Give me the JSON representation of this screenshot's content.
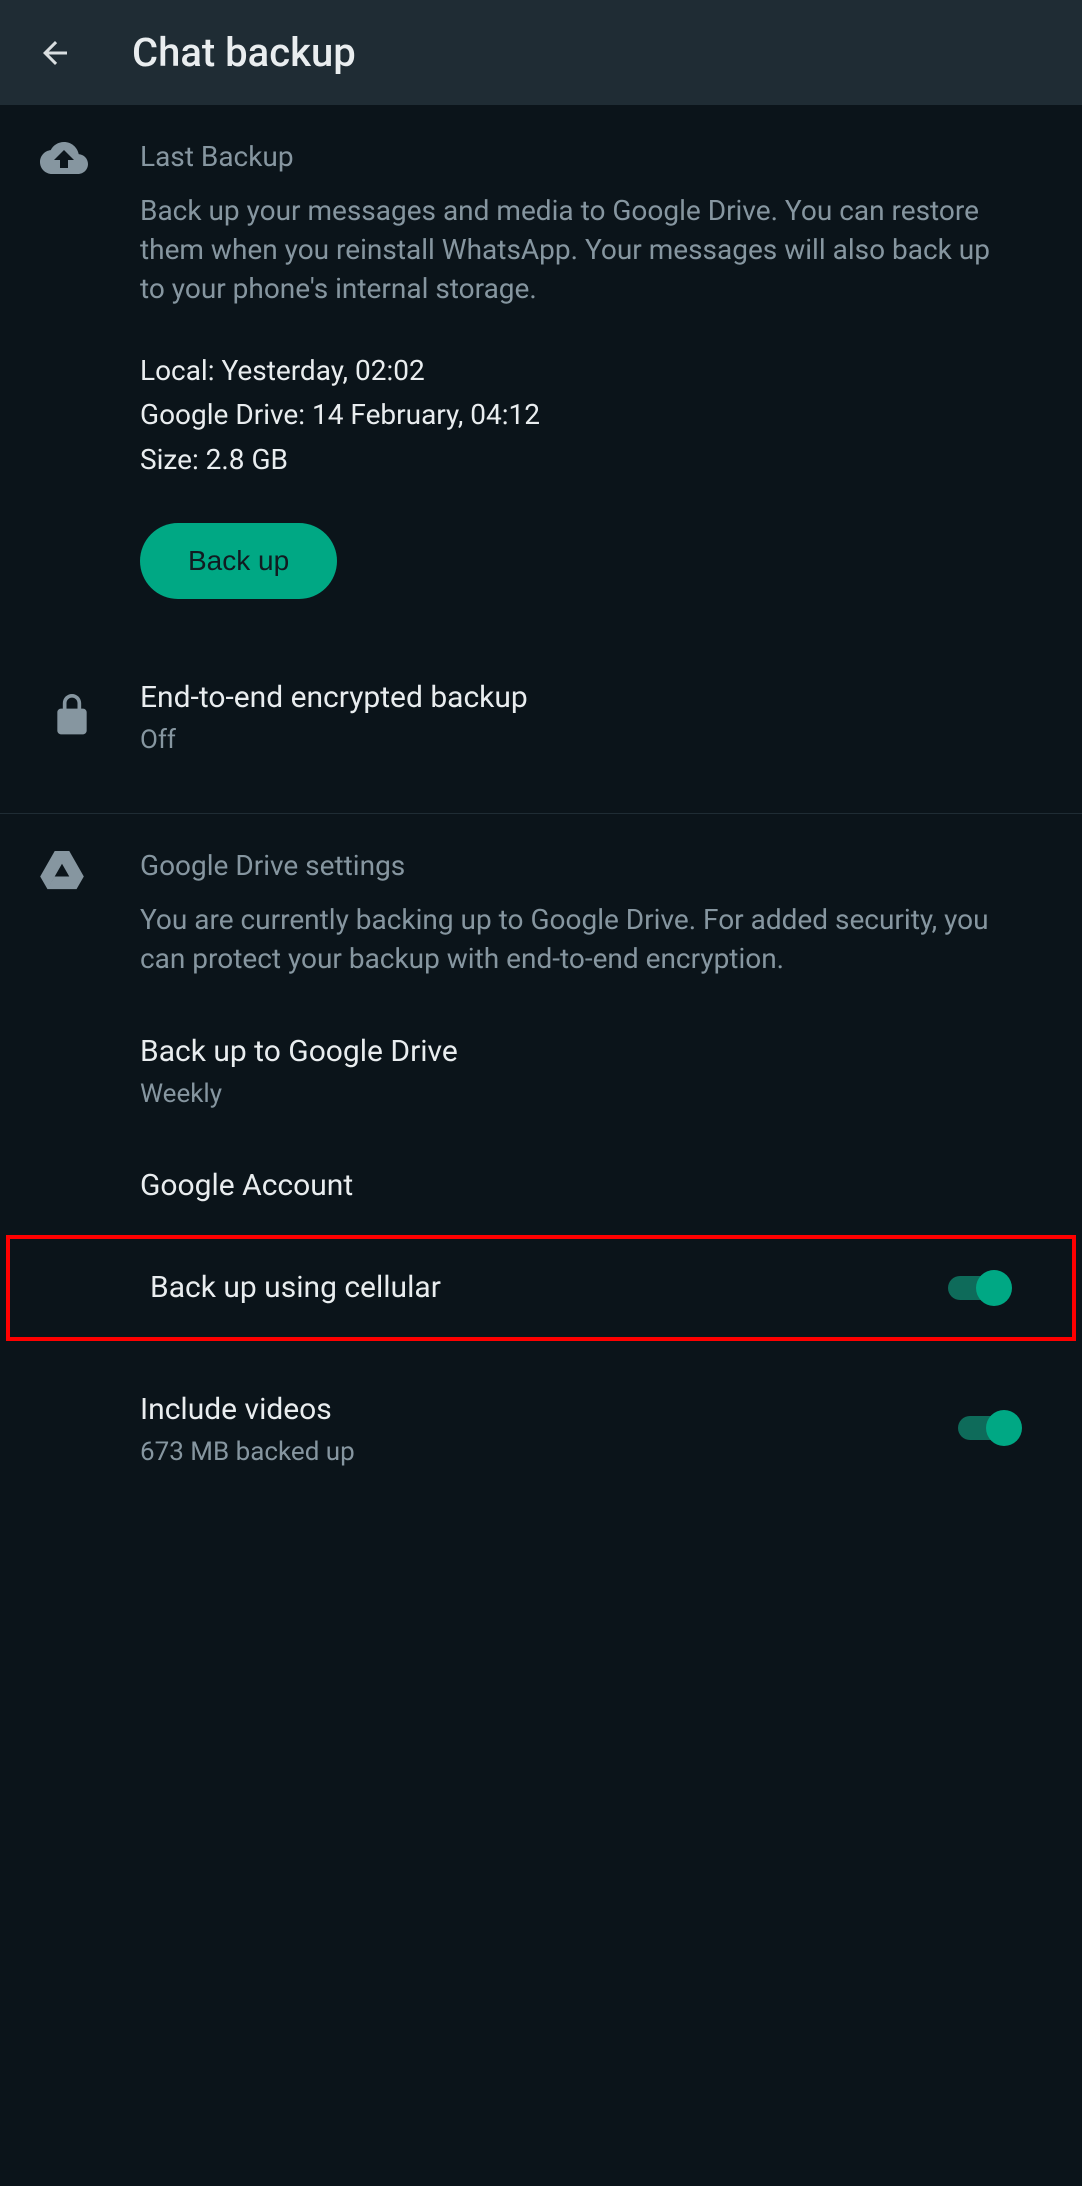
{
  "header": {
    "title": "Chat backup"
  },
  "lastBackup": {
    "title": "Last Backup",
    "description": "Back up your messages and media to Google Drive. You can restore them when you reinstall WhatsApp. Your messages will also back up to your phone's internal storage.",
    "local": "Local: Yesterday, 02:02",
    "googleDrive": "Google Drive: 14 February, 04:12",
    "size": "Size: 2.8 GB",
    "buttonLabel": "Back up"
  },
  "e2e": {
    "title": "End-to-end encrypted backup",
    "status": "Off"
  },
  "driveSettings": {
    "title": "Google Drive settings",
    "description": "You are currently backing up to Google Drive. For added security, you can protect your backup with end-to-end encryption."
  },
  "settings": {
    "backupFrequency": {
      "title": "Back up to Google Drive",
      "value": "Weekly"
    },
    "googleAccount": {
      "title": "Google Account"
    },
    "cellular": {
      "title": "Back up using cellular",
      "on": true
    },
    "videos": {
      "title": "Include videos",
      "subtitle": "673 MB backed up",
      "on": true
    }
  }
}
